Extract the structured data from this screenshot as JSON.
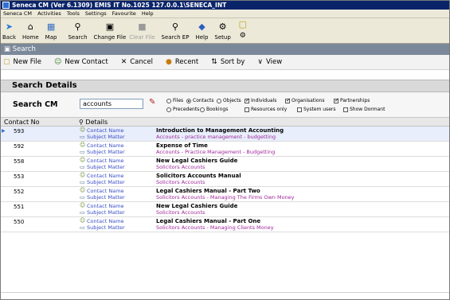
{
  "window": {
    "title": "Seneca CM  (Ver 6.1309)  EMIS IT No.1025  127.0.0.1\\SENECA_INT"
  },
  "menubar": {
    "items": [
      "Seneca CM",
      "Activities",
      "Tools",
      "Settings",
      "Favourite",
      "Help"
    ]
  },
  "toolbar": {
    "back": "Back",
    "home": "Home",
    "map": "Map",
    "search": "Search",
    "change_file": "Change File",
    "clear_file": "Clear File",
    "search_ep": "Search EP",
    "help": "Help",
    "setup": "Setup"
  },
  "search_bar": {
    "title": "Search"
  },
  "actions": {
    "new_file": "New File",
    "new_contact": "New Contact",
    "cancel": "Cancel",
    "recent": "Recent",
    "sort_by": "Sort by",
    "view": "View"
  },
  "details": {
    "header": "Search Details"
  },
  "criteria": {
    "label": "Search CM",
    "value": "accounts",
    "radios": {
      "files": "Files",
      "contacts": "Contacts",
      "objects": "Objects",
      "precedents": "Precedents",
      "bookings": "Bookings"
    },
    "checks": {
      "individuals": "Individuals",
      "organisations": "Organisations",
      "partnerships": "Partnerships",
      "resources_only": "Resources only",
      "system_users": "System users",
      "show_dormant": "Show Dormant"
    }
  },
  "grid": {
    "col_contact_no": "Contact No",
    "col_details": "Details",
    "label_contact": "Contact Name",
    "label_subject": "Subject Matter",
    "rows": [
      {
        "no": "593",
        "title": "Introduction to Management Accounting",
        "subject": "Accounts - practice management - budgetting"
      },
      {
        "no": "592",
        "title": "Expense of Time",
        "subject": "Accounts - Practice Management - Budgetting"
      },
      {
        "no": "558",
        "title": "New Legal Cashiers Guide",
        "subject": "Solicitors Accounts"
      },
      {
        "no": "553",
        "title": "Solicitors Accounts Manual",
        "subject": "Solicitors Accounts"
      },
      {
        "no": "552",
        "title": "Legal Cashiers Manual - Part Two",
        "subject": "Solicitors Accounts - Managing The Firms Own Money"
      },
      {
        "no": "551",
        "title": "New Legal Cashiers Guide",
        "subject": "Solicitors Accounts"
      },
      {
        "no": "550",
        "title": "Legal Cashiers Manual - Part One",
        "subject": "Solicitors Accounts -  Managing Clients Money"
      }
    ]
  }
}
